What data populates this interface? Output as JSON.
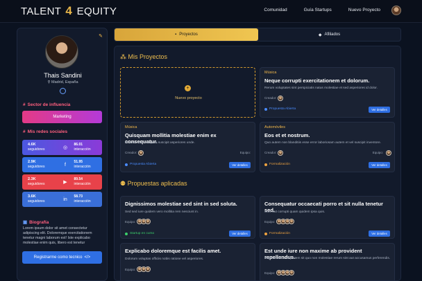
{
  "nav": {
    "logo_a": "TALENT",
    "logo_b": "4",
    "logo_c": "EQUITY",
    "links": [
      "Comunidad",
      "Guía Startups",
      "Nuevo Proyecto"
    ]
  },
  "profile": {
    "name": "Thais Sandini",
    "location": "Madrid, España"
  },
  "influence": {
    "title": "Sector de influencia",
    "value": "Marketing"
  },
  "networks": {
    "title": "Mis redes sociales",
    "items": [
      {
        "name": "instagram",
        "followers": "4.6K",
        "followers_label": "seguidores",
        "interaction": "86.01",
        "interaction_label": "interacción",
        "color": "#7a3bd6",
        "icon": "instagram-icon"
      },
      {
        "name": "facebook",
        "followers": "2.9K",
        "followers_label": "seguidores",
        "interaction": "51.95",
        "interaction_label": "interacción",
        "color": "#2f6fe3",
        "icon": "facebook-icon"
      },
      {
        "name": "youtube",
        "followers": "2.3K",
        "followers_label": "seguidores",
        "interaction": "89.54",
        "interaction_label": "interacción",
        "color": "#e8424a",
        "icon": "youtube-icon"
      },
      {
        "name": "linkedin",
        "followers": "3.6K",
        "followers_label": "seguidores",
        "interaction": "58.73",
        "interaction_label": "interacción",
        "color": "#3a6fd8",
        "icon": "linkedin-icon"
      }
    ]
  },
  "bio": {
    "title": "Biografía",
    "text": "Lorem ipsum dolor sit amet consectetur adipiscing elit. Doloremque exercitationem tenetur magni laborum est! Iste explicabo molestiae enim quis, libero est tenetur"
  },
  "register_button": "Registrarme como tecnico",
  "tabs": {
    "projects": "Proyectos",
    "affiliates": "Afiliados"
  },
  "projects": {
    "title": "Mis Proyectos",
    "new_label": "Nuevo proyecto",
    "cards": [
      {
        "category": "Música",
        "title": "Neque corrupti exercitationem et dolorum.",
        "desc": "Rerum voluptates sint perspiciatis natus molestiae et sed asperiores id dolor.",
        "creator": "Creador:",
        "team": "",
        "status": "Propuesta Abierta",
        "status_color": "#4a8cff",
        "button": "Ver detalles"
      },
      {
        "category": "Música",
        "title": "Quisquam mollitia molestiae enim ex consequatur.",
        "desc": "Et amet vero voluptas suscipit asperiores unde.",
        "creator": "Creador:",
        "team": "Equipo:",
        "status": "Propuesta Abierta",
        "status_color": "#4a8cff",
        "button": "Ver detalles"
      },
      {
        "category": "Automóviles",
        "title": "Eos et et nostrum.",
        "desc": "Quo autem non blanditiis esse error laboriosam autem et vel suscipit inventore.",
        "creator": "Creador:",
        "team": "Equipo:",
        "status": "Formalización",
        "status_color": "#f0a440",
        "button": "Ver detalles"
      }
    ]
  },
  "applied": {
    "title": "Propuestas aplicadas",
    "cards": [
      {
        "title": "Dignissimos molestiae sed sint in sed soluta.",
        "desc": "Sed sed iure quidem vero mollitia rem nesciunt in.",
        "team": "Equipo:",
        "status": "Startup en curso",
        "status_color": "#3ccf6b",
        "button": "Ver detalles"
      },
      {
        "title": "Consequatur occaecati porro et sit nulla tenetur sed.",
        "desc": "Sunt aut corrupti quam quidem ipsa quis.",
        "team": "Equipo:",
        "status": "Formalización",
        "status_color": "#f0a440",
        "button": "Ver detalles"
      },
      {
        "title": "Explicabo doloremque est facilis amet.",
        "desc": "Dolorum voluptas officiis nobis ratione vel asperiores.",
        "team": "Equipo:"
      },
      {
        "title": "Est unde iure non maxime ab provident repellendus.",
        "desc": "Repellendus voluptatem sit quo non molestiae rerum sint aut accusamus perferendis.",
        "team": "Equipo:"
      }
    ]
  }
}
